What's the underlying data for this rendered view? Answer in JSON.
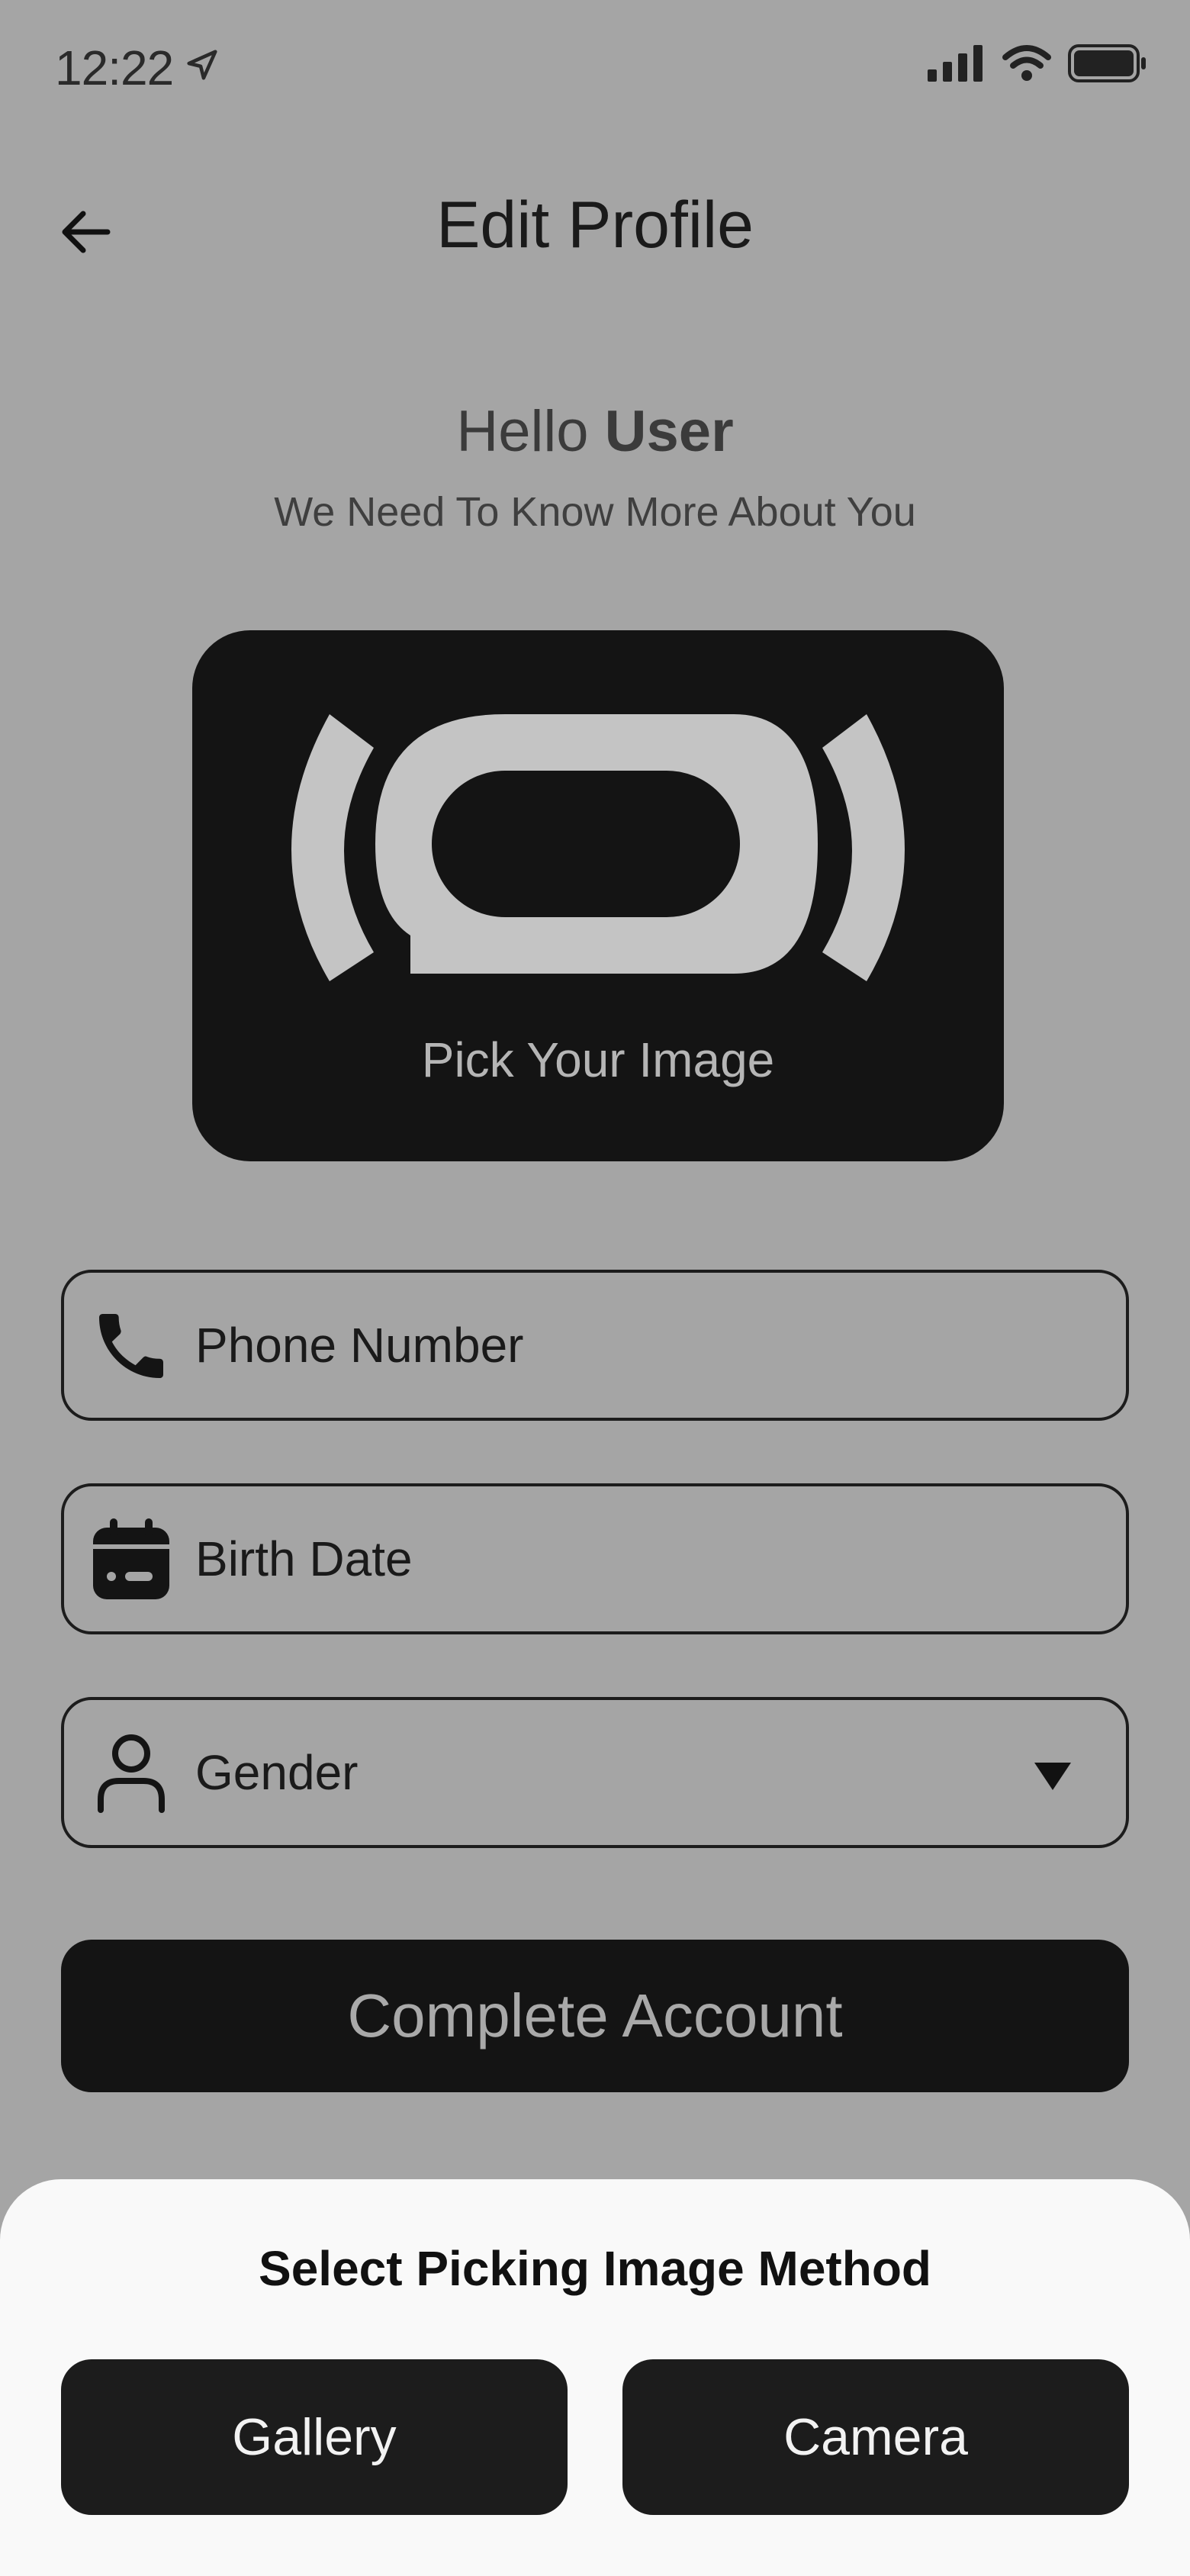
{
  "status_bar": {
    "time": "12:22"
  },
  "header": {
    "title": "Edit Profile"
  },
  "greeting": {
    "prefix": "Hello ",
    "name": "User"
  },
  "subtitle": "We Need To Know More About You",
  "image_picker": {
    "label": "Pick Your Image"
  },
  "fields": {
    "phone": "Phone Number",
    "birth_date": "Birth Date",
    "gender": "Gender"
  },
  "primary_button": "Complete Account",
  "sheet": {
    "title": "Select Picking Image Method",
    "gallery_label": "Gallery",
    "camera_label": "Camera"
  },
  "icons": [
    "location-arrow-icon",
    "signal-icon",
    "wifi-icon",
    "battery-icon",
    "back-arrow-icon",
    "image-picker-icon",
    "phone-icon",
    "calendar-icon",
    "person-icon",
    "dropdown-arrow-icon"
  ],
  "colors": {
    "background": "#a5a5a5",
    "dark": "#141414",
    "sheet": "#f9f9f9"
  }
}
